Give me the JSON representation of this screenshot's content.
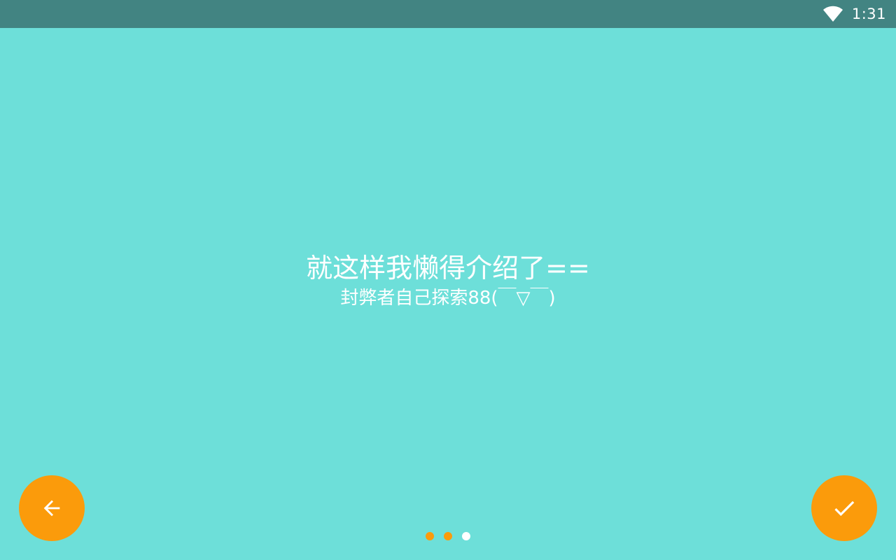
{
  "colors": {
    "status_bar": "#428482",
    "background": "#6ddfd9",
    "accent": "#fb9b0b",
    "text": "#ffffff",
    "dot_active": "#ffffff",
    "dot_inactive": "#fb9b0b"
  },
  "status_bar": {
    "time": "1:31",
    "wifi_icon": "wifi-full-icon"
  },
  "slide": {
    "title": "就这样我懒得介绍了==",
    "subtitle": "封弊者自己探索88(￣▽￣)"
  },
  "navigation": {
    "back_icon": "arrow-left-icon",
    "done_icon": "check-icon",
    "page_count": 3,
    "current_page": 3
  }
}
